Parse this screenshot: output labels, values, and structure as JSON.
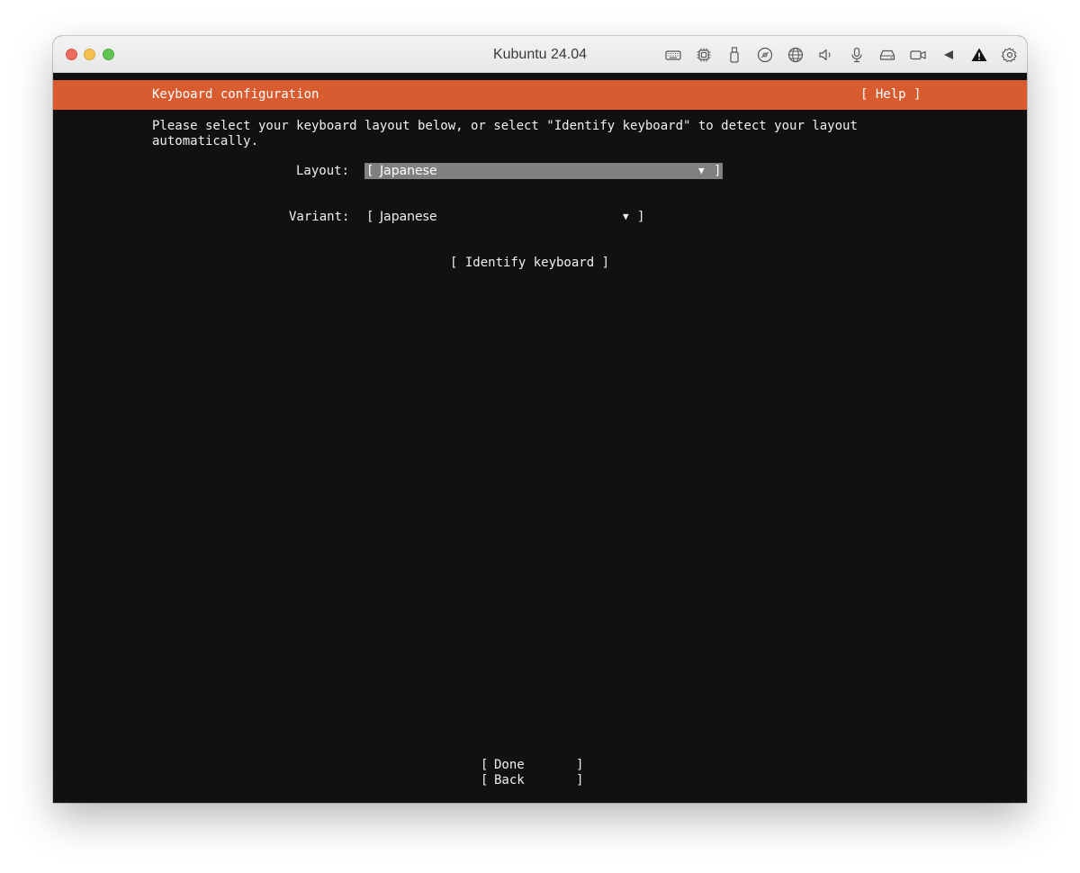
{
  "window": {
    "title": "Kubuntu 24.04",
    "toolbar_icons": [
      "keyboard-icon",
      "cpu-icon",
      "usb-icon",
      "cd-icon",
      "network-icon",
      "speaker-icon",
      "microphone-icon",
      "disk-icon",
      "camera-icon",
      "back-arrow-icon",
      "warning-icon",
      "gear-icon"
    ]
  },
  "header": {
    "title": "Keyboard configuration",
    "help": "[ Help ]"
  },
  "intro": "Please select your keyboard layout below, or select \"Identify keyboard\" to detect your layout\nautomatically.",
  "layout": {
    "label": "Layout:",
    "open": "[",
    "value": "Japanese",
    "arrow": "▼",
    "close": "]"
  },
  "variant": {
    "label": "Variant:",
    "open": "[",
    "value": "Japanese",
    "arrow": "▼",
    "close": "]"
  },
  "identify": "[ Identify keyboard ]",
  "buttons": {
    "done": {
      "open": "[",
      "label": "Done",
      "close": "]"
    },
    "back": {
      "open": "[",
      "label": "Back",
      "close": "]"
    }
  },
  "colors": {
    "header_bg": "#d95c30",
    "screen_bg": "#111111",
    "selected_bg": "#808080"
  }
}
